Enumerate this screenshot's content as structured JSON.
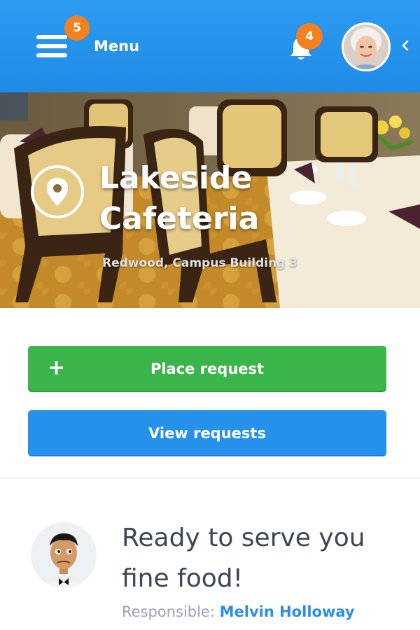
{
  "header": {
    "menu_label": "Menu",
    "menu_badge": "5",
    "notification_badge": "4",
    "accent_color": "#2591ea",
    "badge_color": "#f5801f"
  },
  "venue": {
    "name": "Lakeside Cafeteria",
    "location": "Redwood, Campus Building 3"
  },
  "actions": {
    "place_request": "Place request",
    "view_requests": "View requests",
    "place_icon": "plus-icon",
    "primary_green": "#3ab54a",
    "primary_blue": "#2591ea"
  },
  "staff": {
    "heading": "Ready to serve you fine food!",
    "responsible_label": "Responsible:",
    "responsible_name": "Melvin Holloway"
  }
}
